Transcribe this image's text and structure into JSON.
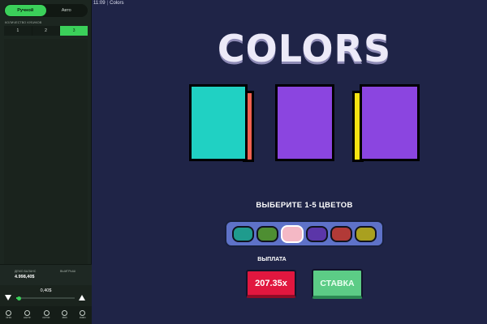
{
  "sidebar": {
    "modes": [
      {
        "label": "Ручной",
        "active": true
      },
      {
        "label": "Авто",
        "active": false
      }
    ],
    "cube_count_label": "КОЛИЧЕСТВО КУБИКОВ",
    "cube_counts": [
      {
        "label": "1",
        "active": false
      },
      {
        "label": "2",
        "active": false
      },
      {
        "label": "3",
        "active": true
      }
    ],
    "balance_label": "ДЕМО БАЛАНС",
    "balance_value": "4.998,40$",
    "payout_label": "ВЫИГРЫШ",
    "bet_value": "0,40$",
    "bet_slider_fraction": 0.05,
    "footer_icons": [
      "play-icon",
      "settings-icon",
      "history-icon",
      "sound-icon",
      "info-icon"
    ],
    "footer_icon_labels": [
      "ИГРА",
      "НАСТР.",
      "ИСТОР.",
      "ЗВУК",
      "ИНФО"
    ]
  },
  "topbar": {
    "time": "11:09",
    "app_name": "Colors"
  },
  "game": {
    "title": "COLORS",
    "cubes": [
      {
        "face_color": "#20d1c3",
        "side_color": "#f06151",
        "side": "right"
      },
      {
        "face_color": "#8b45e0",
        "side_color": null,
        "side": "none"
      },
      {
        "face_color": "#8b45e0",
        "side_color": "#f5e312",
        "side": "left"
      }
    ],
    "choose_label": "ВЫБЕРИТЕ 1-5 ЦВЕТОВ",
    "palette": [
      {
        "name": "teal",
        "color": "#1f9b8d",
        "selected": false
      },
      {
        "name": "green",
        "color": "#4e8e32",
        "selected": false
      },
      {
        "name": "pink",
        "color": "#f4b8c5",
        "selected": true
      },
      {
        "name": "purple",
        "color": "#5b36a8",
        "selected": false
      },
      {
        "name": "red",
        "color": "#b23a37",
        "selected": false
      },
      {
        "name": "olive",
        "color": "#a9a01f",
        "selected": false
      }
    ],
    "payout_title": "ВЫПЛАТА",
    "payout_value": "207.35x",
    "bet_button_label": "СТАВКА"
  }
}
